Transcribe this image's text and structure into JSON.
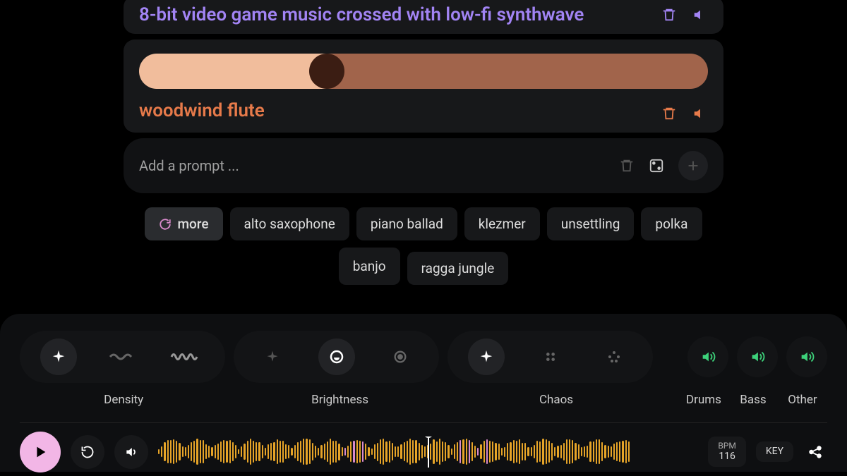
{
  "prompts": [
    {
      "text": "8-bit video game music crossed with low-fi synthwave",
      "color": "#a284f4"
    },
    {
      "text": "woodwind flute",
      "color": "#e77a4a",
      "slider_value": 0.33
    }
  ],
  "add_prompt_placeholder": "Add a prompt ...",
  "chips": {
    "more_label": "more",
    "items": [
      "alto saxophone",
      "piano ballad",
      "klezmer",
      "unsettling",
      "polka",
      "banjo",
      "ragga jungle"
    ]
  },
  "controls": {
    "density_label": "Density",
    "brightness_label": "Brightness",
    "chaos_label": "Chaos",
    "drums_label": "Drums",
    "bass_label": "Bass",
    "other_label": "Other"
  },
  "transport": {
    "bpm_label": "BPM",
    "bpm_value": "116",
    "key_label": "KEY"
  }
}
